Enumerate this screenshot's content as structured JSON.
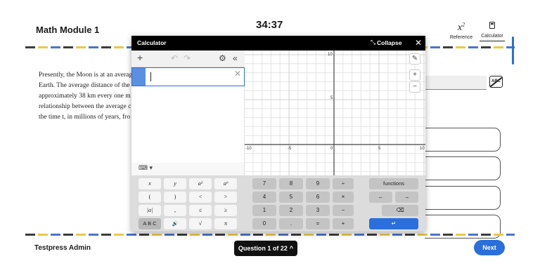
{
  "header": {
    "module_title": "Math Module 1",
    "timer": "34:37",
    "reference_label": "Reference",
    "calculator_label": "Calculator"
  },
  "passage": {
    "lines": [
      "Presently, the Moon is at an averag",
      "Earth. The average distance of the",
      "approximately 38 km every one m",
      "relationship between the average c",
      "the time t, in millions of years, fro"
    ]
  },
  "answer_area": {
    "abc_label": "ABC"
  },
  "footer": {
    "user": "Testpress Admin",
    "question_nav": "Question 1 of 22",
    "next_label": "Next"
  },
  "calculator": {
    "title": "Calculator",
    "collapse_label": "Collapse",
    "graph_labels": {
      "x_ticks": [
        "-10",
        "-5",
        "0",
        "5",
        "10"
      ],
      "y_ticks": [
        "10",
        "5"
      ]
    },
    "keypad": {
      "row1": [
        "x",
        "y",
        "a²",
        "aᵇ",
        "7",
        "8",
        "9",
        "÷",
        "functions"
      ],
      "row2": [
        "(",
        ")",
        "<",
        ">",
        "4",
        "5",
        "6",
        "×",
        "←",
        "→"
      ],
      "row3": [
        "|a|",
        ",",
        "≤",
        "≥",
        "1",
        "2",
        "3",
        "−"
      ],
      "row4": [
        "A B C",
        "🔊",
        "√",
        "π",
        "0",
        ".",
        "=",
        "+"
      ]
    }
  }
}
